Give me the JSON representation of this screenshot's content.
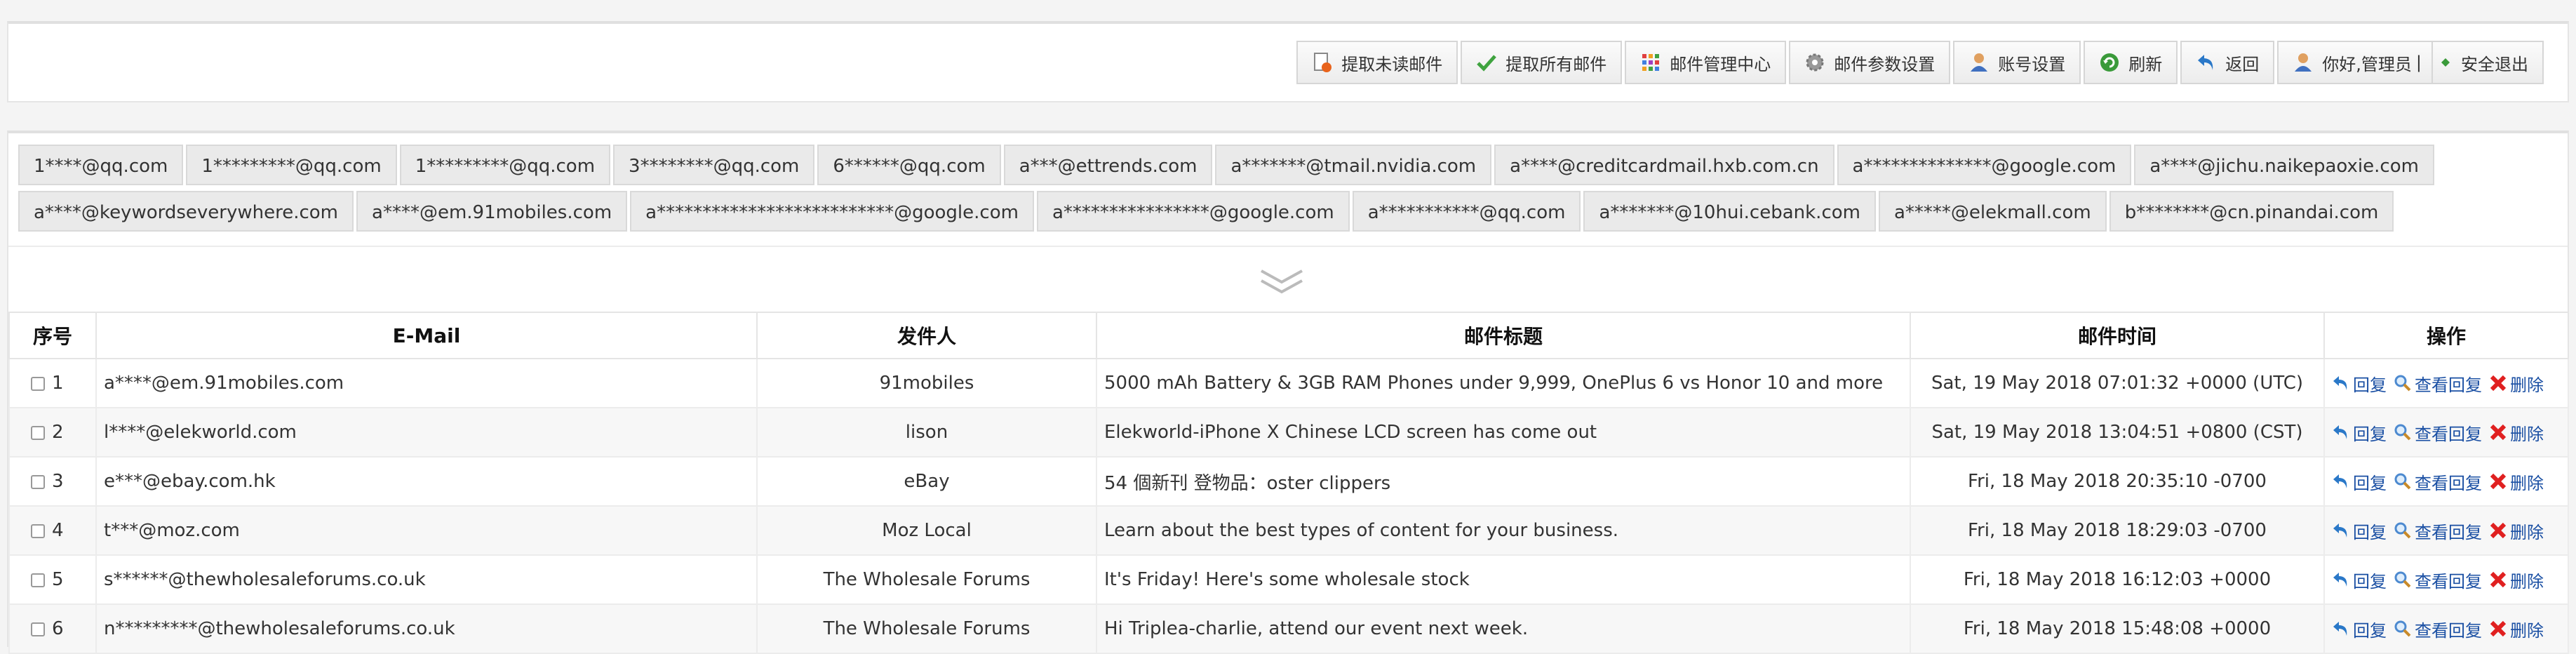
{
  "toolbar": {
    "items": [
      {
        "label": "提取未读邮件",
        "icon": "unread-mail-icon"
      },
      {
        "label": "提取所有邮件",
        "icon": "checkmark-icon"
      },
      {
        "label": "邮件管理中心",
        "icon": "grid-icon"
      },
      {
        "label": "邮件参数设置",
        "icon": "gear-icon"
      },
      {
        "label": "账号设置",
        "icon": "account-icon"
      },
      {
        "label": "刷新",
        "icon": "refresh-icon"
      },
      {
        "label": "返回",
        "icon": "back-arrow-icon"
      }
    ],
    "greeting": "你好,管理员",
    "separator": "|",
    "logout": "安全退出"
  },
  "accounts": {
    "row1": [
      "1****@qq.com",
      "1*********@qq.com",
      "1*********@qq.com",
      "3********@qq.com",
      "6******@qq.com",
      "a***@ettrends.com",
      "a*******@tmail.nvidia.com",
      "a****@creditcardmail.hxb.com.cn",
      "a**************@google.com",
      "a****@jichu.naikepaoxie.com"
    ],
    "row2": [
      "a****@keywordseverywhere.com",
      "a****@em.91mobiles.com",
      "a**************************@google.com",
      "a****************@google.com",
      "a***********@qq.com",
      "a*******@10hui.cebank.com",
      "a*****@elekmall.com",
      "b********@cn.pinandai.com"
    ]
  },
  "table": {
    "headers": {
      "index": "序号",
      "email": "E-Mail",
      "sender": "发件人",
      "subject": "邮件标题",
      "time": "邮件时间",
      "actions": "操作"
    },
    "actions": {
      "reply": "回复",
      "view_reply": "查看回复",
      "delete": "删除"
    },
    "rows": [
      {
        "index": "1",
        "email": "a****@em.91mobiles.com",
        "sender": "91mobiles",
        "subject": "5000 mAh Battery & 3GB RAM Phones under 9,999, OnePlus 6 vs Honor 10 and more",
        "time": "Sat, 19 May 2018 07:01:32 +0000 (UTC)"
      },
      {
        "index": "2",
        "email": "l****@elekworld.com",
        "sender": "lison",
        "subject": "Elekworld-iPhone X Chinese LCD screen has come out",
        "time": "Sat, 19 May 2018 13:04:51 +0800 (CST)"
      },
      {
        "index": "3",
        "email": "e***@ebay.com.hk",
        "sender": "eBay",
        "subject": "54 個新刊 登物品：oster clippers",
        "time": "Fri, 18 May 2018 20:35:10 -0700"
      },
      {
        "index": "4",
        "email": "t***@moz.com",
        "sender": "Moz Local",
        "subject": "Learn about the best types of content for your business.",
        "time": "Fri, 18 May 2018 18:29:03 -0700"
      },
      {
        "index": "5",
        "email": "s******@thewholesaleforums.co.uk",
        "sender": "The Wholesale Forums",
        "subject": "It's Friday! Here's some wholesale stock",
        "time": "Fri, 18 May 2018 16:12:03 +0000"
      },
      {
        "index": "6",
        "email": "n*********@thewholesaleforums.co.uk",
        "sender": "The Wholesale Forums",
        "subject": "Hi Triplea-charlie, attend our event next week.",
        "time": "Fri, 18 May 2018 15:48:08 +0000"
      }
    ]
  }
}
